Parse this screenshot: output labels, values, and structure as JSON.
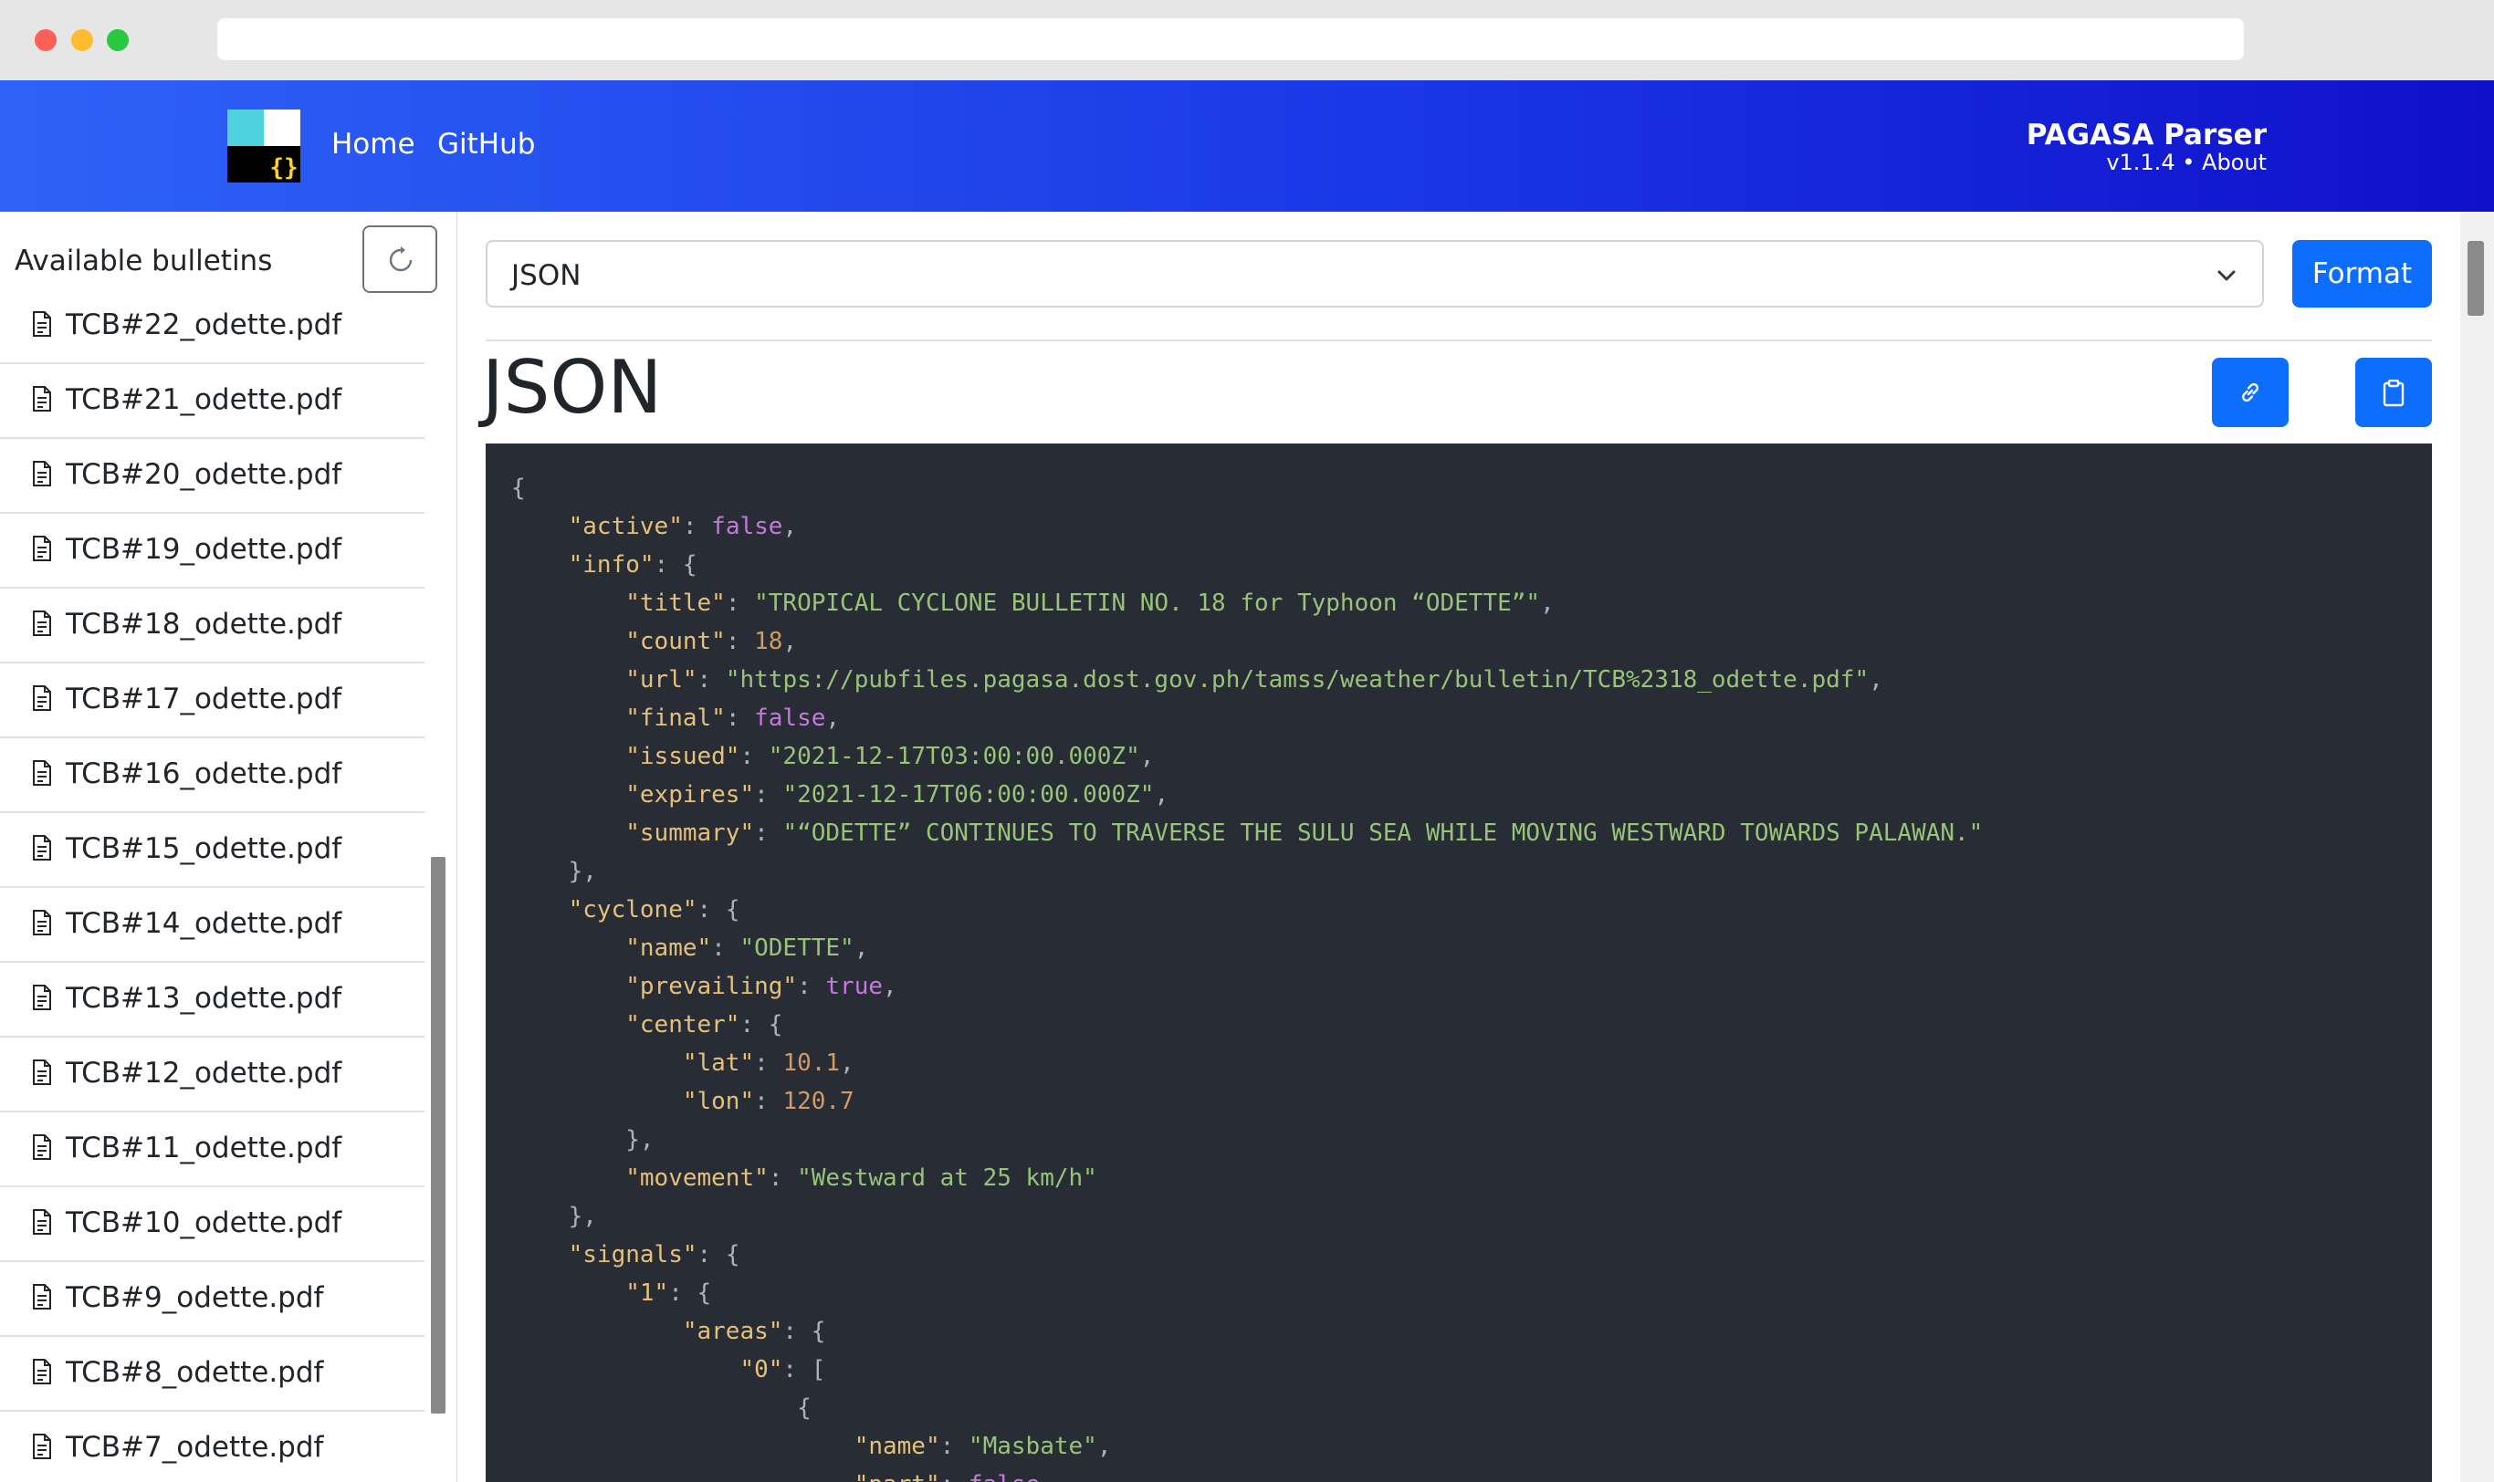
{
  "window": {
    "url": ""
  },
  "navbar": {
    "links": [
      "Home",
      "GitHub"
    ],
    "brand_title": "PAGASA Parser",
    "version": "v1.1.4",
    "separator": "•",
    "about_label": "About",
    "colors": {
      "gradient_start": "#2e62f6",
      "gradient_end": "#1010c8"
    }
  },
  "sidebar": {
    "title": "Available bulletins",
    "refresh_icon": "refresh-icon",
    "items": [
      "TCB#22_odette.pdf",
      "TCB#21_odette.pdf",
      "TCB#20_odette.pdf",
      "TCB#19_odette.pdf",
      "TCB#18_odette.pdf",
      "TCB#17_odette.pdf",
      "TCB#16_odette.pdf",
      "TCB#15_odette.pdf",
      "TCB#14_odette.pdf",
      "TCB#13_odette.pdf",
      "TCB#12_odette.pdf",
      "TCB#11_odette.pdf",
      "TCB#10_odette.pdf",
      "TCB#9_odette.pdf",
      "TCB#8_odette.pdf",
      "TCB#7_odette.pdf"
    ]
  },
  "main": {
    "format_select": {
      "selected": "JSON"
    },
    "format_button": "Format",
    "heading": "JSON",
    "accent_color": "#0d6efd",
    "code_lines": [
      [
        [
          "p",
          "{"
        ]
      ],
      [
        [
          "p",
          "    "
        ],
        [
          "k",
          "\"active\""
        ],
        [
          "p",
          ": "
        ],
        [
          "b",
          "false"
        ],
        [
          "p",
          ","
        ]
      ],
      [
        [
          "p",
          "    "
        ],
        [
          "k",
          "\"info\""
        ],
        [
          "p",
          ": {"
        ]
      ],
      [
        [
          "p",
          "        "
        ],
        [
          "k",
          "\"title\""
        ],
        [
          "p",
          ": "
        ],
        [
          "s",
          "\"TROPICAL CYCLONE BULLETIN NO. 18 for Typhoon “ODETTE”\""
        ],
        [
          "p",
          ","
        ]
      ],
      [
        [
          "p",
          "        "
        ],
        [
          "k",
          "\"count\""
        ],
        [
          "p",
          ": "
        ],
        [
          "n",
          "18"
        ],
        [
          "p",
          ","
        ]
      ],
      [
        [
          "p",
          "        "
        ],
        [
          "k",
          "\"url\""
        ],
        [
          "p",
          ": "
        ],
        [
          "s",
          "\"https://pubfiles.pagasa.dost.gov.ph/tamss/weather/bulletin/TCB%2318_odette.pdf\""
        ],
        [
          "p",
          ","
        ]
      ],
      [
        [
          "p",
          "        "
        ],
        [
          "k",
          "\"final\""
        ],
        [
          "p",
          ": "
        ],
        [
          "b",
          "false"
        ],
        [
          "p",
          ","
        ]
      ],
      [
        [
          "p",
          "        "
        ],
        [
          "k",
          "\"issued\""
        ],
        [
          "p",
          ": "
        ],
        [
          "s",
          "\"2021-12-17T03:00:00.000Z\""
        ],
        [
          "p",
          ","
        ]
      ],
      [
        [
          "p",
          "        "
        ],
        [
          "k",
          "\"expires\""
        ],
        [
          "p",
          ": "
        ],
        [
          "s",
          "\"2021-12-17T06:00:00.000Z\""
        ],
        [
          "p",
          ","
        ]
      ],
      [
        [
          "p",
          "        "
        ],
        [
          "k",
          "\"summary\""
        ],
        [
          "p",
          ": "
        ],
        [
          "s",
          "\"“ODETTE” CONTINUES TO TRAVERSE THE SULU SEA WHILE MOVING WESTWARD TOWARDS PALAWAN.\""
        ]
      ],
      [
        [
          "p",
          "    },"
        ]
      ],
      [
        [
          "p",
          "    "
        ],
        [
          "k",
          "\"cyclone\""
        ],
        [
          "p",
          ": {"
        ]
      ],
      [
        [
          "p",
          "        "
        ],
        [
          "k",
          "\"name\""
        ],
        [
          "p",
          ": "
        ],
        [
          "s",
          "\"ODETTE\""
        ],
        [
          "p",
          ","
        ]
      ],
      [
        [
          "p",
          "        "
        ],
        [
          "k",
          "\"prevailing\""
        ],
        [
          "p",
          ": "
        ],
        [
          "b",
          "true"
        ],
        [
          "p",
          ","
        ]
      ],
      [
        [
          "p",
          "        "
        ],
        [
          "k",
          "\"center\""
        ],
        [
          "p",
          ": {"
        ]
      ],
      [
        [
          "p",
          "            "
        ],
        [
          "k",
          "\"lat\""
        ],
        [
          "p",
          ": "
        ],
        [
          "n",
          "10.1"
        ],
        [
          "p",
          ","
        ]
      ],
      [
        [
          "p",
          "            "
        ],
        [
          "k",
          "\"lon\""
        ],
        [
          "p",
          ": "
        ],
        [
          "n",
          "120.7"
        ]
      ],
      [
        [
          "p",
          "        },"
        ]
      ],
      [
        [
          "p",
          "        "
        ],
        [
          "k",
          "\"movement\""
        ],
        [
          "p",
          ": "
        ],
        [
          "s",
          "\"Westward at 25 km/h\""
        ]
      ],
      [
        [
          "p",
          "    },"
        ]
      ],
      [
        [
          "p",
          "    "
        ],
        [
          "k",
          "\"signals\""
        ],
        [
          "p",
          ": {"
        ]
      ],
      [
        [
          "p",
          "        "
        ],
        [
          "k",
          "\"1\""
        ],
        [
          "p",
          ": {"
        ]
      ],
      [
        [
          "p",
          "            "
        ],
        [
          "k",
          "\"areas\""
        ],
        [
          "p",
          ": {"
        ]
      ],
      [
        [
          "p",
          "                "
        ],
        [
          "k",
          "\"0\""
        ],
        [
          "p",
          ": ["
        ]
      ],
      [
        [
          "p",
          "                    {"
        ]
      ],
      [
        [
          "p",
          "                        "
        ],
        [
          "k",
          "\"name\""
        ],
        [
          "p",
          ": "
        ],
        [
          "s",
          "\"Masbate\""
        ],
        [
          "p",
          ","
        ]
      ],
      [
        [
          "p",
          "                        "
        ],
        [
          "k",
          "\"part\""
        ],
        [
          "p",
          ": "
        ],
        [
          "b",
          "false"
        ],
        [
          "p",
          ","
        ]
      ]
    ]
  }
}
